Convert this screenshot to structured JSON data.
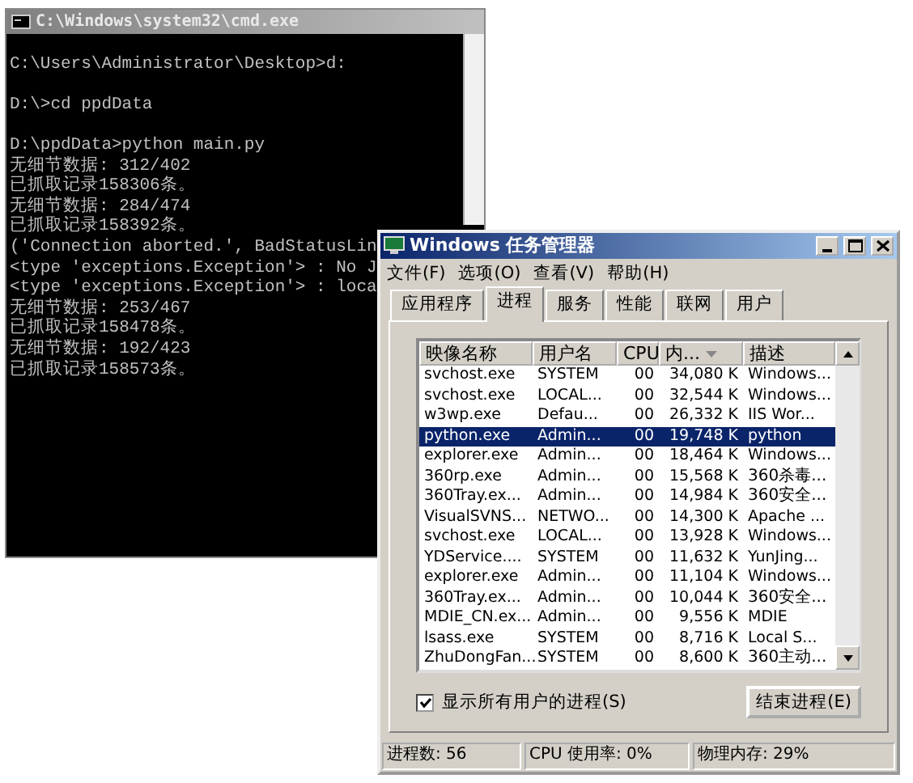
{
  "console": {
    "title": "C:\\Windows\\system32\\cmd.exe",
    "blocks": [
      [
        "C:\\Users\\Administrator\\Desktop>d:"
      ],
      [
        "D:\\>cd ppdData"
      ],
      [
        "D:\\ppdData>python main.py",
        "无细节数据: 312/402",
        "已抓取记录158306条。",
        "无细节数据: 284/474",
        "已抓取记录158392条。",
        "('Connection aborted.', BadStatusLin",
        "<type 'exceptions.Exception'> : No J",
        "<type 'exceptions.Exception'> : loca",
        "无细节数据: 253/467",
        "已抓取记录158478条。",
        "无细节数据: 192/423",
        "已抓取记录158573条。"
      ]
    ]
  },
  "task_manager": {
    "title": "Windows 任务管理器",
    "menu": [
      "文件(F)",
      "选项(O)",
      "查看(V)",
      "帮助(H)"
    ],
    "tabs": [
      {
        "label": "应用程序",
        "selected": false
      },
      {
        "label": "进程",
        "selected": true
      },
      {
        "label": "服务",
        "selected": false
      },
      {
        "label": "性能",
        "selected": false
      },
      {
        "label": "联网",
        "selected": false
      },
      {
        "label": "用户",
        "selected": false
      }
    ],
    "columns": [
      "映像名称",
      "用户名",
      "CPU",
      "内...",
      "描述"
    ],
    "rows": [
      {
        "cells": [
          "svchost.exe",
          "SYSTEM",
          "00",
          "34,080 K",
          "Windows..."
        ],
        "selected": false
      },
      {
        "cells": [
          "svchost.exe",
          "LOCAL...",
          "00",
          "32,544 K",
          "Windows..."
        ],
        "selected": false
      },
      {
        "cells": [
          "w3wp.exe",
          "Defau...",
          "00",
          "26,332 K",
          "IIS Wor..."
        ],
        "selected": false
      },
      {
        "cells": [
          "python.exe",
          "Admin...",
          "00",
          "19,748 K",
          "python"
        ],
        "selected": true
      },
      {
        "cells": [
          "explorer.exe",
          "Admin...",
          "00",
          "18,464 K",
          "Windows..."
        ],
        "selected": false
      },
      {
        "cells": [
          "360rp.exe",
          "Admin...",
          "00",
          "15,568 K",
          "360杀毒..."
        ],
        "selected": false
      },
      {
        "cells": [
          "360Tray.ex...",
          "Admin...",
          "00",
          "14,984 K",
          "360安全..."
        ],
        "selected": false
      },
      {
        "cells": [
          "VisualSVNS...",
          "NETWO...",
          "00",
          "14,300 K",
          "Apache ..."
        ],
        "selected": false
      },
      {
        "cells": [
          "svchost.exe",
          "LOCAL...",
          "00",
          "13,928 K",
          "Windows..."
        ],
        "selected": false
      },
      {
        "cells": [
          "YDService....",
          "SYSTEM",
          "00",
          "11,632 K",
          "YunJing..."
        ],
        "selected": false
      },
      {
        "cells": [
          "explorer.exe",
          "Admin...",
          "00",
          "11,104 K",
          "Windows..."
        ],
        "selected": false
      },
      {
        "cells": [
          "360Tray.ex...",
          "Admin...",
          "00",
          "10,044 K",
          "360安全..."
        ],
        "selected": false
      },
      {
        "cells": [
          "MDIE_CN.ex...",
          "Admin...",
          "00",
          "9,556 K",
          "MDIE"
        ],
        "selected": false
      },
      {
        "cells": [
          "lsass.exe",
          "SYSTEM",
          "00",
          "8,716 K",
          "Local S..."
        ],
        "selected": false
      },
      {
        "cells": [
          "ZhuDongFan...",
          "SYSTEM",
          "00",
          "8,600 K",
          "360主动..."
        ],
        "selected": false
      }
    ],
    "show_all_users": {
      "label": "显示所有用户的进程(S)",
      "checked": true
    },
    "end_process_button": "结束进程(E)",
    "status_bar": [
      "进程数: 56",
      "CPU 使用率: 0%",
      "物理内存: 29%"
    ]
  }
}
